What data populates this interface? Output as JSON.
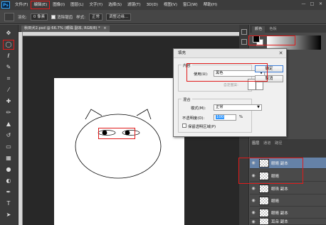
{
  "app": {
    "logo": "Ps"
  },
  "menubar": {
    "items": [
      "文件(F)",
      "编辑(E)",
      "图像(I)",
      "图层(L)",
      "文字(Y)",
      "选择(S)",
      "滤镜(T)",
      "3D(D)",
      "视图(V)",
      "窗口(W)",
      "帮助(H)"
    ],
    "active_index": 1,
    "window_controls": [
      "—",
      "□",
      "✕"
    ]
  },
  "options_bar": {
    "feather_label": "羽化:",
    "feather_value": "0 像素",
    "aa_label": "消除锯齿",
    "style_label": "样式:",
    "style_value": "正常",
    "refine_label": "调整边缘..."
  },
  "document": {
    "tab_title": "秋田犬2.psd @ 66.7% (眼珠 副本, RGB/8) *",
    "tab_close": "×"
  },
  "panels": {
    "color_tabs": [
      "颜色",
      "色板"
    ],
    "layers_tabs": [
      "图层",
      "通道",
      "路径"
    ],
    "layers": [
      {
        "name": "眼睛 副本",
        "selected": true
      },
      {
        "name": "眼睛",
        "selected": false
      },
      {
        "name": "眼珠 副本",
        "selected": false
      },
      {
        "name": "眼睛",
        "selected": false
      },
      {
        "name": "眼睛 副本",
        "selected": false
      },
      {
        "name": "耳朵 副本",
        "selected": false
      }
    ]
  },
  "dialog": {
    "title": "填充",
    "close": "✕",
    "content_group": "内容",
    "use_label": "使用(U):",
    "use_value": "黑色",
    "custom_pattern": "自定图案:",
    "blend_group": "混合",
    "mode_label": "模式(M):",
    "mode_value": "正常",
    "opacity_label": "不透明度(O):",
    "opacity_value": "100",
    "opacity_unit": "%",
    "preserve_label": "保留透明区域(P)",
    "ok_label": "确定",
    "cancel_label": "取消"
  },
  "colors": {
    "highlight": "#e01b1b",
    "layer_selected": "#6582a8"
  }
}
